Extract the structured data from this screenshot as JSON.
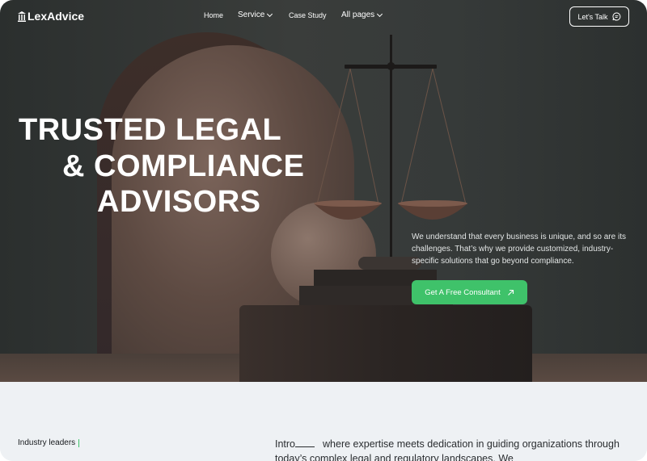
{
  "nav": {
    "logo_text": "LexAdvice",
    "links": [
      {
        "label": "Home"
      },
      {
        "label": "Service"
      },
      {
        "label": "Case Study"
      },
      {
        "label": "All pages"
      }
    ],
    "cta_label": "Let's Talk"
  },
  "hero": {
    "headline_lines": [
      "TRUSTED LEGAL",
      "& COMPLIANCE",
      "ADVISORS"
    ],
    "description": "We understand that every business is unique, and so are its challenges. That’s why we provide customized, industry-specific solutions that go beyond compliance.",
    "cta_label": "Get A Free Consultant"
  },
  "intro": {
    "label": "Industry leaders",
    "lead": "Intro",
    "text": "where expertise meets dedication in guiding organizations through today’s complex legal and regulatory landscapes. We"
  },
  "colors": {
    "accent": "#3fc26a",
    "hero_bg": "#363a39",
    "section_bg": "#eef1f4"
  },
  "icons": {
    "logo": "pillar-icon",
    "chat": "chat-bubble-icon",
    "cta_arrow": "arrow-up-right-icon",
    "dropdown": "chevron-down-icon"
  }
}
